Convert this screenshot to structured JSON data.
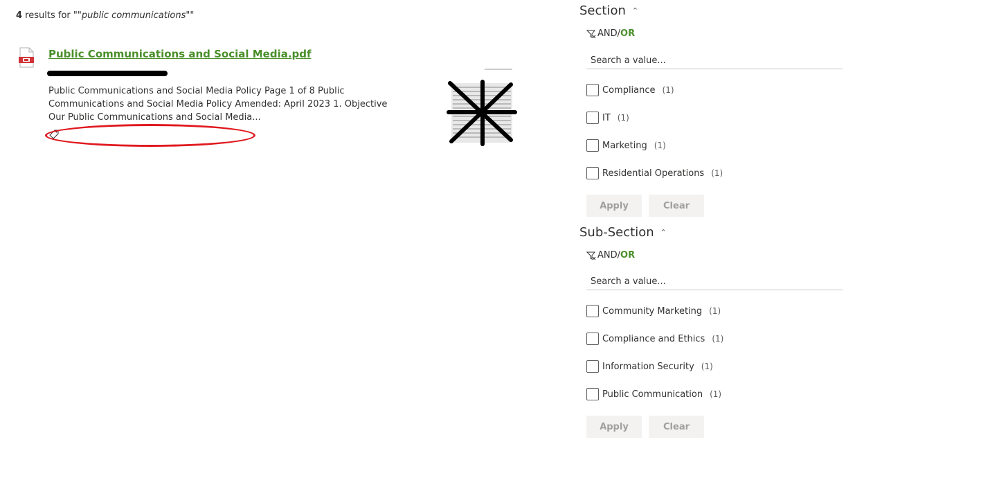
{
  "results": {
    "count": "4",
    "text_before": " results for \"",
    "query": "\"public communications\"",
    "text_after": "\""
  },
  "result_item": {
    "title": "Public Communications and Social Media.pdf",
    "snippet": "Public Communications and Social Media Policy Page 1 of 8 Public Communications and Social Media Policy Amended: April 2023 1. Objective Our Public Communications and Social Media...",
    "file_icon": "pdf-file-icon",
    "tag_icon": "tag-icon"
  },
  "filters": {
    "section": {
      "title": "Section",
      "and_label": "AND/",
      "or_label": "OR",
      "search_placeholder": "Search a value...",
      "options": [
        {
          "label": "Compliance",
          "count": "(1)"
        },
        {
          "label": "IT",
          "count": "(1)"
        },
        {
          "label": "Marketing",
          "count": "(1)"
        },
        {
          "label": "Residential Operations",
          "count": "(1)"
        }
      ],
      "apply_label": "Apply",
      "clear_label": "Clear"
    },
    "sub_section": {
      "title": "Sub-Section",
      "and_label": "AND/",
      "or_label": "OR",
      "search_placeholder": "Search a value...",
      "options": [
        {
          "label": "Community Marketing",
          "count": "(1)"
        },
        {
          "label": "Compliance and Ethics",
          "count": "(1)"
        },
        {
          "label": "Information Security",
          "count": "(1)"
        },
        {
          "label": "Public Communication",
          "count": "(1)"
        }
      ],
      "apply_label": "Apply",
      "clear_label": "Clear"
    }
  },
  "colors": {
    "link_green": "#4a8f2b",
    "highlight_red": "#e0191f"
  }
}
